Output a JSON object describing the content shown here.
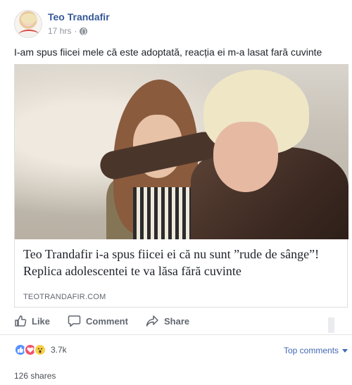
{
  "post": {
    "author": "Teo Trandafir",
    "time": "17 hrs",
    "separator": "·",
    "privacy_icon": "globe-icon",
    "text": "I-am spus fiicei mele că este adoptată, reacția ei m-a lasat fară cuvinte"
  },
  "link": {
    "title": "Teo Trandafir i-a spus fiicei ei că nu sunt ”rude de sânge”! Replica adolescentei te va lăsa fără cuvinte",
    "domain": "TEOTRANDAFIR.COM"
  },
  "actions": {
    "like": "Like",
    "comment": "Comment",
    "share": "Share"
  },
  "stats": {
    "reactions": [
      "like",
      "love",
      "wow"
    ],
    "reaction_count": "3.7k",
    "top_comments": "Top comments",
    "shares": "126 shares"
  },
  "colors": {
    "author_blue": "#365899",
    "link_blue": "#4267b2",
    "meta_gray": "#90949c",
    "action_gray": "#616770"
  }
}
